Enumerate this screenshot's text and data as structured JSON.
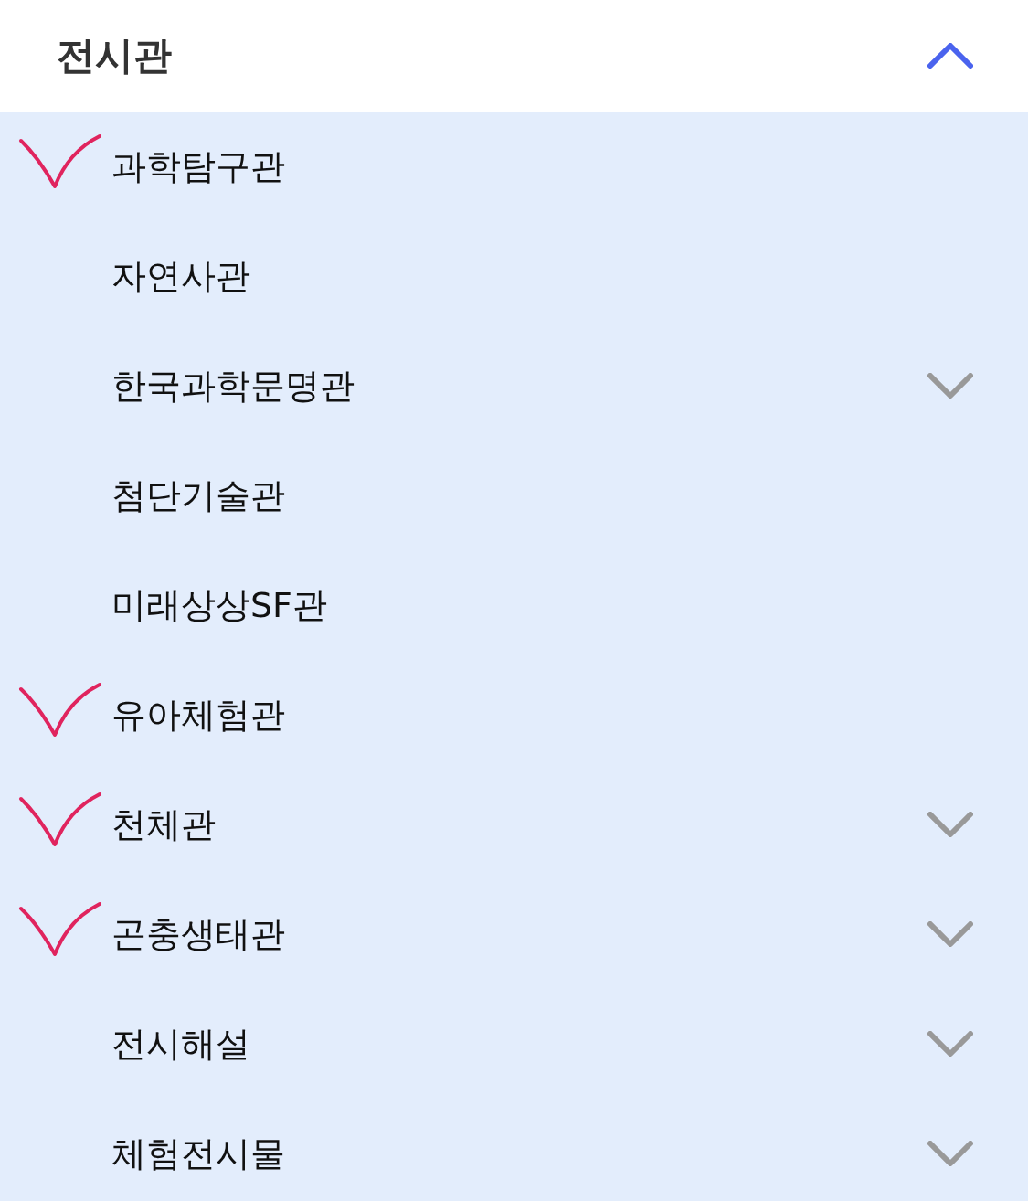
{
  "section": {
    "title": "전시관",
    "expanded": true
  },
  "items": [
    {
      "label": "과학탐구관",
      "has_submenu": false,
      "marked": true
    },
    {
      "label": "자연사관",
      "has_submenu": false,
      "marked": false
    },
    {
      "label": "한국과학문명관",
      "has_submenu": true,
      "marked": false
    },
    {
      "label": "첨단기술관",
      "has_submenu": false,
      "marked": false
    },
    {
      "label": "미래상상SF관",
      "has_submenu": false,
      "marked": false
    },
    {
      "label": "유아체험관",
      "has_submenu": false,
      "marked": true
    },
    {
      "label": "천체관",
      "has_submenu": true,
      "marked": true
    },
    {
      "label": "곤충생태관",
      "has_submenu": true,
      "marked": true
    },
    {
      "label": "전시해설",
      "has_submenu": true,
      "marked": false
    },
    {
      "label": "체험전시물",
      "has_submenu": true,
      "marked": false
    }
  ]
}
